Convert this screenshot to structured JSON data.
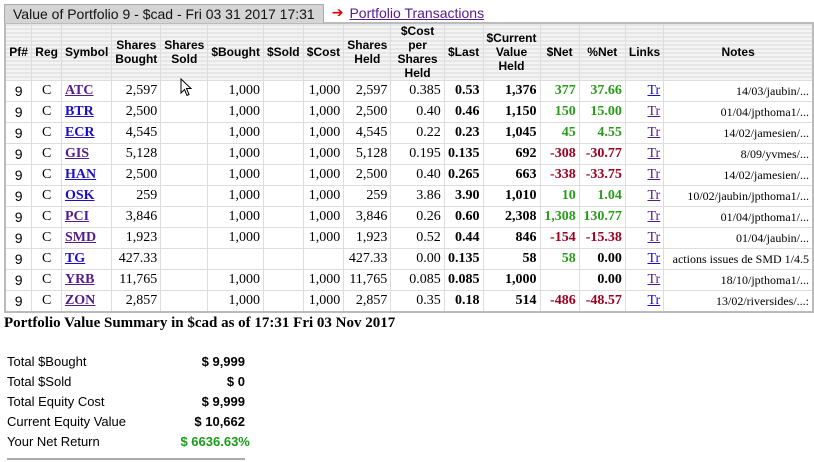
{
  "header": {
    "title": "Value of Portfolio 9 - $cad - Fri 03 31 2017 17:31",
    "transactions_link": "Portfolio Transactions"
  },
  "columns": [
    "Pf#",
    "Reg",
    "Symbol",
    "Shares Bought",
    "Shares Sold",
    "$Bought",
    "$Sold",
    "$Cost",
    "Shares Held",
    "$Cost per Shares Held",
    "$Last",
    "$Current Value Held",
    "$Net",
    "%Net",
    "Links",
    "Notes"
  ],
  "rows": [
    {
      "pf": "9",
      "reg": "C",
      "symbol": "ATC",
      "visited": true,
      "bought": "2,597",
      "sold": "",
      "dbought": "1,000",
      "dsold": "",
      "cost": "1,000",
      "held": "2,597",
      "cps": "0.385",
      "last": "0.53",
      "current": "1,376",
      "net": "377",
      "pnet": "37.66",
      "sign": "pos",
      "link": "Tr",
      "link_visited": false,
      "notes": "14/03/jaubin/..."
    },
    {
      "pf": "9",
      "reg": "C",
      "symbol": "BTR",
      "visited": false,
      "bought": "2,500",
      "sold": "",
      "dbought": "1,000",
      "dsold": "",
      "cost": "1,000",
      "held": "2,500",
      "cps": "0.40",
      "last": "0.46",
      "current": "1,150",
      "net": "150",
      "pnet": "15.00",
      "sign": "pos",
      "link": "Tr",
      "link_visited": true,
      "notes": "01/04/jpthoma1/..."
    },
    {
      "pf": "9",
      "reg": "C",
      "symbol": "ECR",
      "visited": false,
      "bought": "4,545",
      "sold": "",
      "dbought": "1,000",
      "dsold": "",
      "cost": "1,000",
      "held": "4,545",
      "cps": "0.22",
      "last": "0.23",
      "current": "1,045",
      "net": "45",
      "pnet": "4.55",
      "sign": "pos",
      "link": "Tr",
      "link_visited": true,
      "notes": "14/02/jamesien/..."
    },
    {
      "pf": "9",
      "reg": "C",
      "symbol": "GIS",
      "visited": true,
      "bought": "5,128",
      "sold": "",
      "dbought": "1,000",
      "dsold": "",
      "cost": "1,000",
      "held": "5,128",
      "cps": "0.195",
      "last": "0.135",
      "current": "692",
      "net": "-308",
      "pnet": "-30.77",
      "sign": "neg",
      "link": "Tr",
      "link_visited": true,
      "notes": "8/09/yvmes/..."
    },
    {
      "pf": "9",
      "reg": "C",
      "symbol": "HAN",
      "visited": false,
      "bought": "2,500",
      "sold": "",
      "dbought": "1,000",
      "dsold": "",
      "cost": "1,000",
      "held": "2,500",
      "cps": "0.40",
      "last": "0.265",
      "current": "663",
      "net": "-338",
      "pnet": "-33.75",
      "sign": "neg",
      "link": "Tr",
      "link_visited": true,
      "notes": "14/02/jamesien/..."
    },
    {
      "pf": "9",
      "reg": "C",
      "symbol": "OSK",
      "visited": false,
      "bought": "259",
      "sold": "",
      "dbought": "1,000",
      "dsold": "",
      "cost": "1,000",
      "held": "259",
      "cps": "3.86",
      "last": "3.90",
      "current": "1,010",
      "net": "10",
      "pnet": "1.04",
      "sign": "pos",
      "link": "Tr",
      "link_visited": true,
      "notes": "10/02/jaubin/jpthoma1/..."
    },
    {
      "pf": "9",
      "reg": "C",
      "symbol": "PCI",
      "visited": true,
      "bought": "3,846",
      "sold": "",
      "dbought": "1,000",
      "dsold": "",
      "cost": "1,000",
      "held": "3,846",
      "cps": "0.26",
      "last": "0.60",
      "current": "2,308",
      "net": "1,308",
      "pnet": "130.77",
      "sign": "pos",
      "link": "Tr",
      "link_visited": true,
      "notes": "01/04/jpthoma1/..."
    },
    {
      "pf": "9",
      "reg": "C",
      "symbol": "SMD",
      "visited": true,
      "bought": "1,923",
      "sold": "",
      "dbought": "1,000",
      "dsold": "",
      "cost": "1,000",
      "held": "1,923",
      "cps": "0.52",
      "last": "0.44",
      "current": "846",
      "net": "-154",
      "pnet": "-15.38",
      "sign": "neg",
      "link": "Tr",
      "link_visited": true,
      "notes": "01/04/jaubin/..."
    },
    {
      "pf": "9",
      "reg": "C",
      "symbol": "TG",
      "visited": false,
      "bought": "427.33",
      "sold": "",
      "dbought": "",
      "dsold": "",
      "cost": "",
      "held": "427.33",
      "cps": "0.00",
      "last": "0.135",
      "current": "58",
      "net": "58",
      "pnet": "0.00",
      "sign": "pos",
      "pnet_plain": true,
      "link": "Tr",
      "link_visited": false,
      "notes": "actions issues de SMD 1/4.5"
    },
    {
      "pf": "9",
      "reg": "C",
      "symbol": "YRB",
      "visited": true,
      "bought": "11,765",
      "sold": "",
      "dbought": "1,000",
      "dsold": "",
      "cost": "1,000",
      "held": "11,765",
      "cps": "0.085",
      "last": "0.085",
      "current": "1,000",
      "net": "",
      "pnet": "0.00",
      "sign": "pos",
      "pnet_plain": true,
      "link": "Tr",
      "link_visited": true,
      "notes": "18/10/jpthoma1/..."
    },
    {
      "pf": "9",
      "reg": "C",
      "symbol": "ZON",
      "visited": true,
      "bought": "2,857",
      "sold": "",
      "dbought": "1,000",
      "dsold": "",
      "cost": "1,000",
      "held": "2,857",
      "cps": "0.35",
      "last": "0.18",
      "current": "514",
      "net": "-486",
      "pnet": "-48.57",
      "sign": "neg",
      "link": "Tr",
      "link_visited": false,
      "notes": "13/02/riversides/...:"
    }
  ],
  "summary": {
    "title": "Portfolio Value Summary in $cad as of 17:31 Fri 03 Nov 2017",
    "items": [
      {
        "label": "Total $Bought",
        "value": "$ 9,999"
      },
      {
        "label": "Total $Sold",
        "value": "$ 0"
      },
      {
        "label": "Total Equity Cost",
        "value": "$ 9,999"
      },
      {
        "label": "Current Equity Value",
        "value": "$ 10,662"
      },
      {
        "label": "Your Net Return",
        "value": "$ 663",
        "percent": "6.63%"
      }
    ]
  },
  "colors": {
    "positive": "#2a9a1a",
    "negative": "#9a0020",
    "visited_link": "#551a8b",
    "link": "#1a0dcc"
  }
}
